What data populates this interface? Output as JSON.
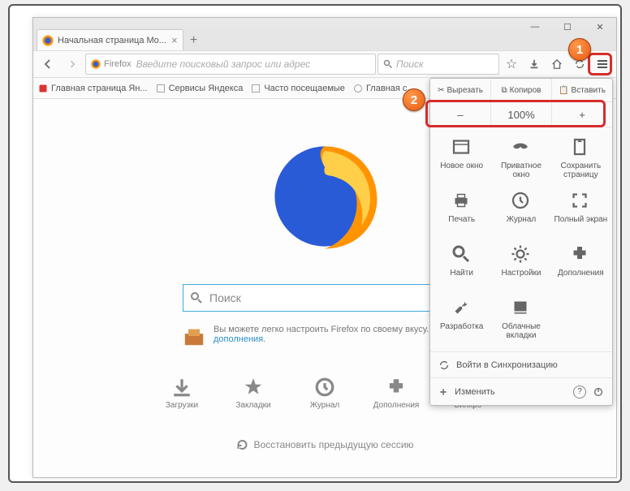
{
  "window": {
    "minimize": "—",
    "maximize": "☐",
    "close": "✕"
  },
  "tab": {
    "title": "Начальная страница Mo...",
    "close": "×",
    "newtab": "+"
  },
  "nav": {
    "identity": "Firefox",
    "url_placeholder": "Введите поисковый запрос или адрес",
    "search_placeholder": "Поиск"
  },
  "bookmarks": [
    "Главная страница Ян...",
    "Сервисы Яндекса",
    "Часто посещаемые",
    "Главная с..."
  ],
  "content": {
    "search_placeholder": "Поиск",
    "tip_text": "Вы можете легко настроить Firefox по своему вкусу. Выбе",
    "tip_link": "дополнения",
    "shortcuts": [
      "Загрузки",
      "Закладки",
      "Журнал",
      "Дополнения",
      "Синхро"
    ],
    "restore": "Восстановить предыдущую сессию"
  },
  "menu": {
    "clip": {
      "cut": "Вырезать",
      "copy": "Копиров",
      "paste": "Вставить"
    },
    "zoom": {
      "minus": "–",
      "value": "100%",
      "plus": "+"
    },
    "grid": [
      "Новое окно",
      "Приватное окно",
      "Сохранить страницу",
      "Печать",
      "Журнал",
      "Полный экран",
      "Найти",
      "Настройки",
      "Дополнения",
      "Разработка",
      "Облачные вкладки",
      ""
    ],
    "sync": "Войти в Синхронизацию",
    "customize": "Изменить"
  }
}
